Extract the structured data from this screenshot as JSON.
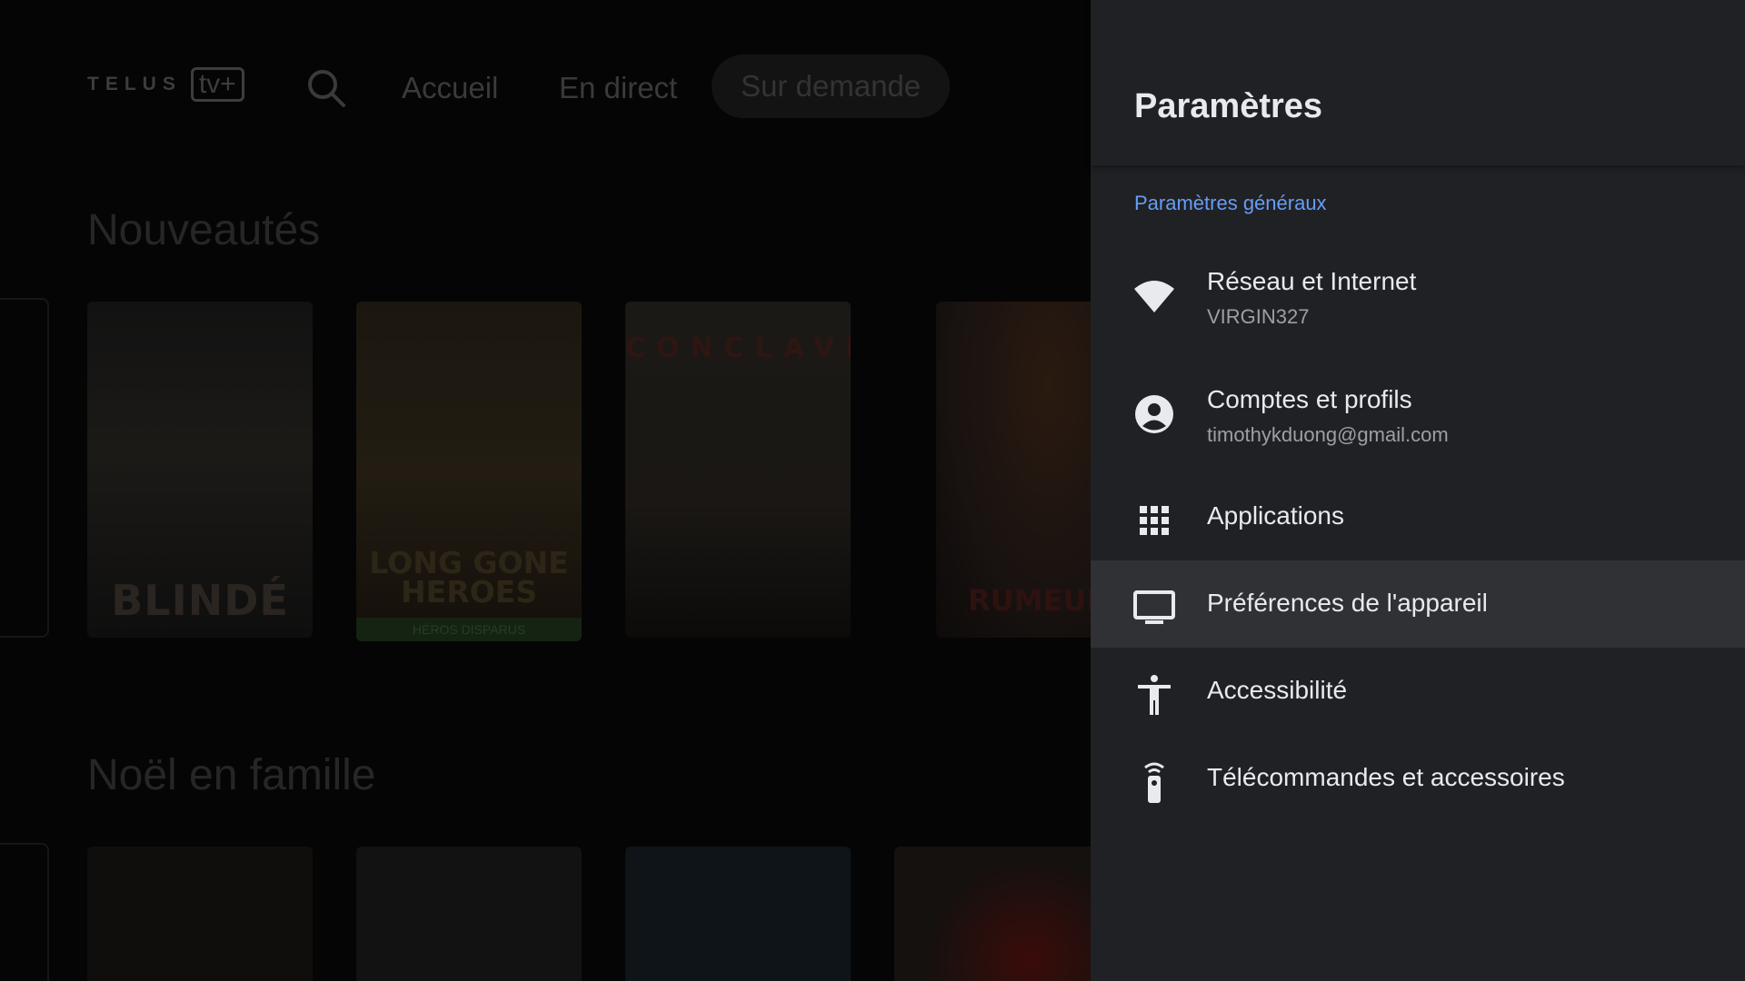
{
  "background_app": {
    "logo": {
      "word": "TELUS",
      "tv": "tv+"
    },
    "nav": {
      "search_icon": "search-icon",
      "accueil": "Accueil",
      "en_direct": "En direct",
      "sur_demande": "Sur demande"
    },
    "rows": [
      {
        "title": "Nouveautés"
      },
      {
        "title": "Noël en famille"
      }
    ],
    "posters": {
      "blinde": "BLINDÉ",
      "long_gone_heroes": "LONG GONE HEROES",
      "heros_disparus": "HÉROS DISPARUS",
      "conclave": "CONCLAVE",
      "rumeurs": "RUMEURS"
    }
  },
  "settings": {
    "title": "Paramètres",
    "section_label": "Paramètres généraux",
    "items": [
      {
        "label": "Réseau et Internet",
        "subtitle": "VIRGIN327",
        "icon": "wifi-icon"
      },
      {
        "label": "Comptes et profils",
        "subtitle": "timothykduong@gmail.com",
        "icon": "account-circle-icon"
      },
      {
        "label": "Applications",
        "icon": "apps-grid-icon"
      },
      {
        "label": "Préférences de l'appareil",
        "icon": "tv-icon",
        "focused": true
      },
      {
        "label": "Accessibilité",
        "icon": "accessibility-icon"
      },
      {
        "label": "Télécommandes et accessoires",
        "icon": "remote-icon"
      }
    ],
    "colors": {
      "panel_bg": "#202124",
      "focused_bg": "#303134",
      "section_accent": "#669df6",
      "text_primary": "#e8eaed",
      "text_secondary": "#9aa0a6"
    }
  }
}
